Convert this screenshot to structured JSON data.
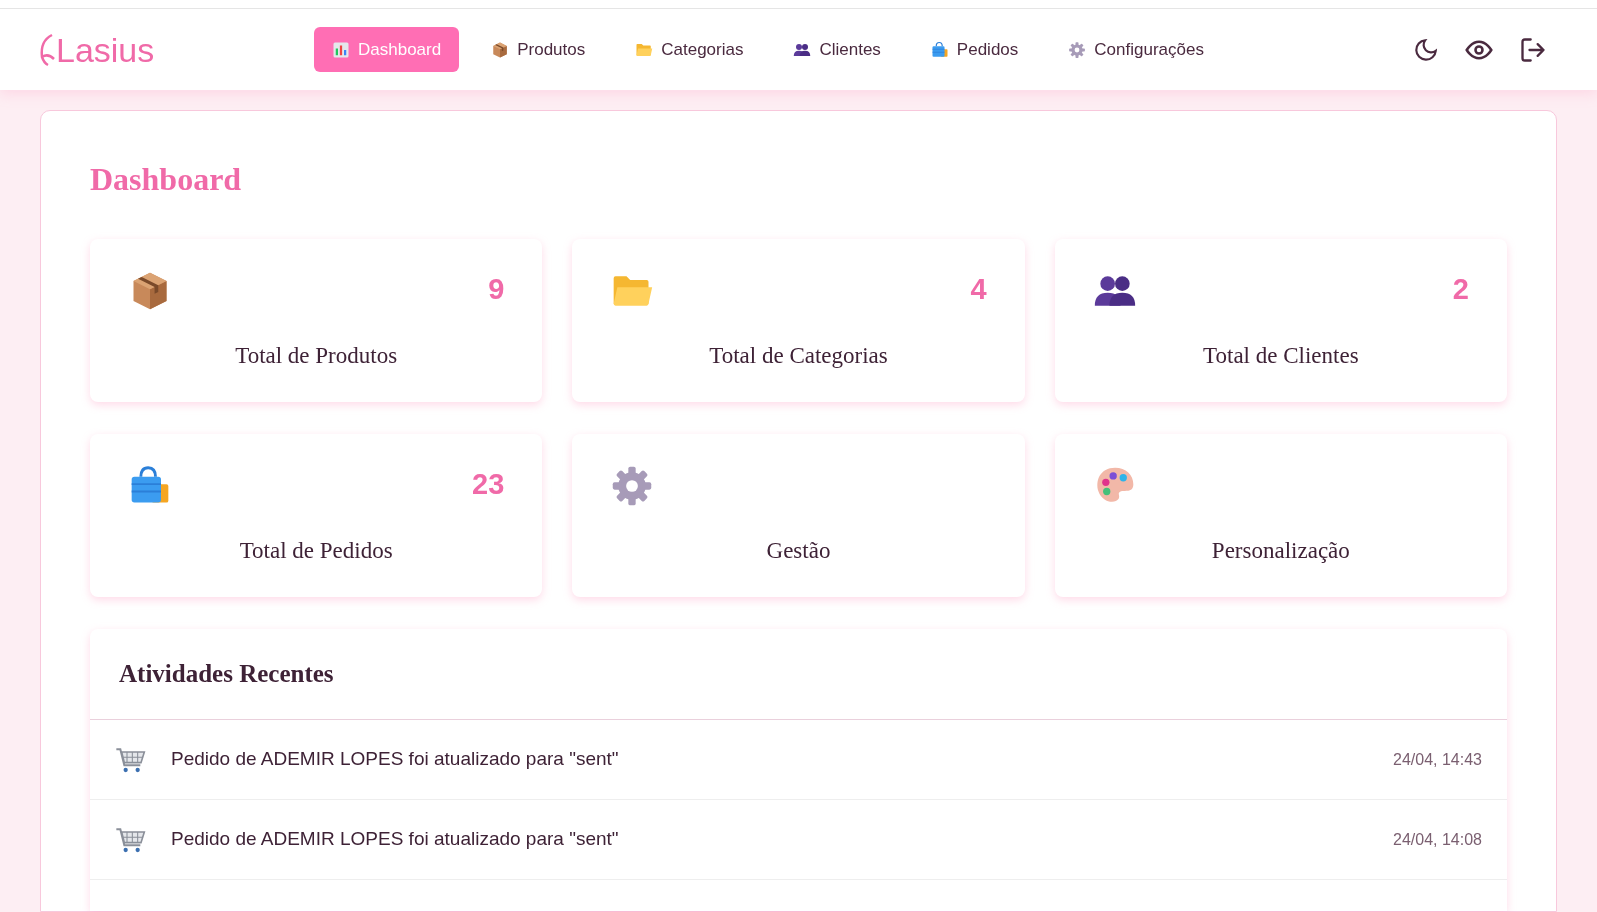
{
  "brand": {
    "name": "Lasius"
  },
  "nav": [
    {
      "label": "Dashboard",
      "selected": true
    },
    {
      "label": "Produtos",
      "selected": false
    },
    {
      "label": "Categorias",
      "selected": false
    },
    {
      "label": "Clientes",
      "selected": false
    },
    {
      "label": "Pedidos",
      "selected": false
    },
    {
      "label": "Configurações",
      "selected": false
    }
  ],
  "page_title": "Dashboard",
  "cards": [
    {
      "value": "9",
      "label": "Total de Produtos"
    },
    {
      "value": "4",
      "label": "Total de Categorias"
    },
    {
      "value": "2",
      "label": "Total de Clientes"
    },
    {
      "value": "23",
      "label": "Total de Pedidos"
    },
    {
      "label": "Gestão"
    },
    {
      "label": "Personalização"
    }
  ],
  "activities": {
    "title": "Atividades Recentes",
    "items": [
      {
        "text": "Pedido de ADEMIR LOPES foi atualizado para \"sent\"",
        "time": "24/04, 14:43"
      },
      {
        "text": "Pedido de ADEMIR LOPES foi atualizado para \"sent\"",
        "time": "24/04, 14:08"
      }
    ]
  }
}
